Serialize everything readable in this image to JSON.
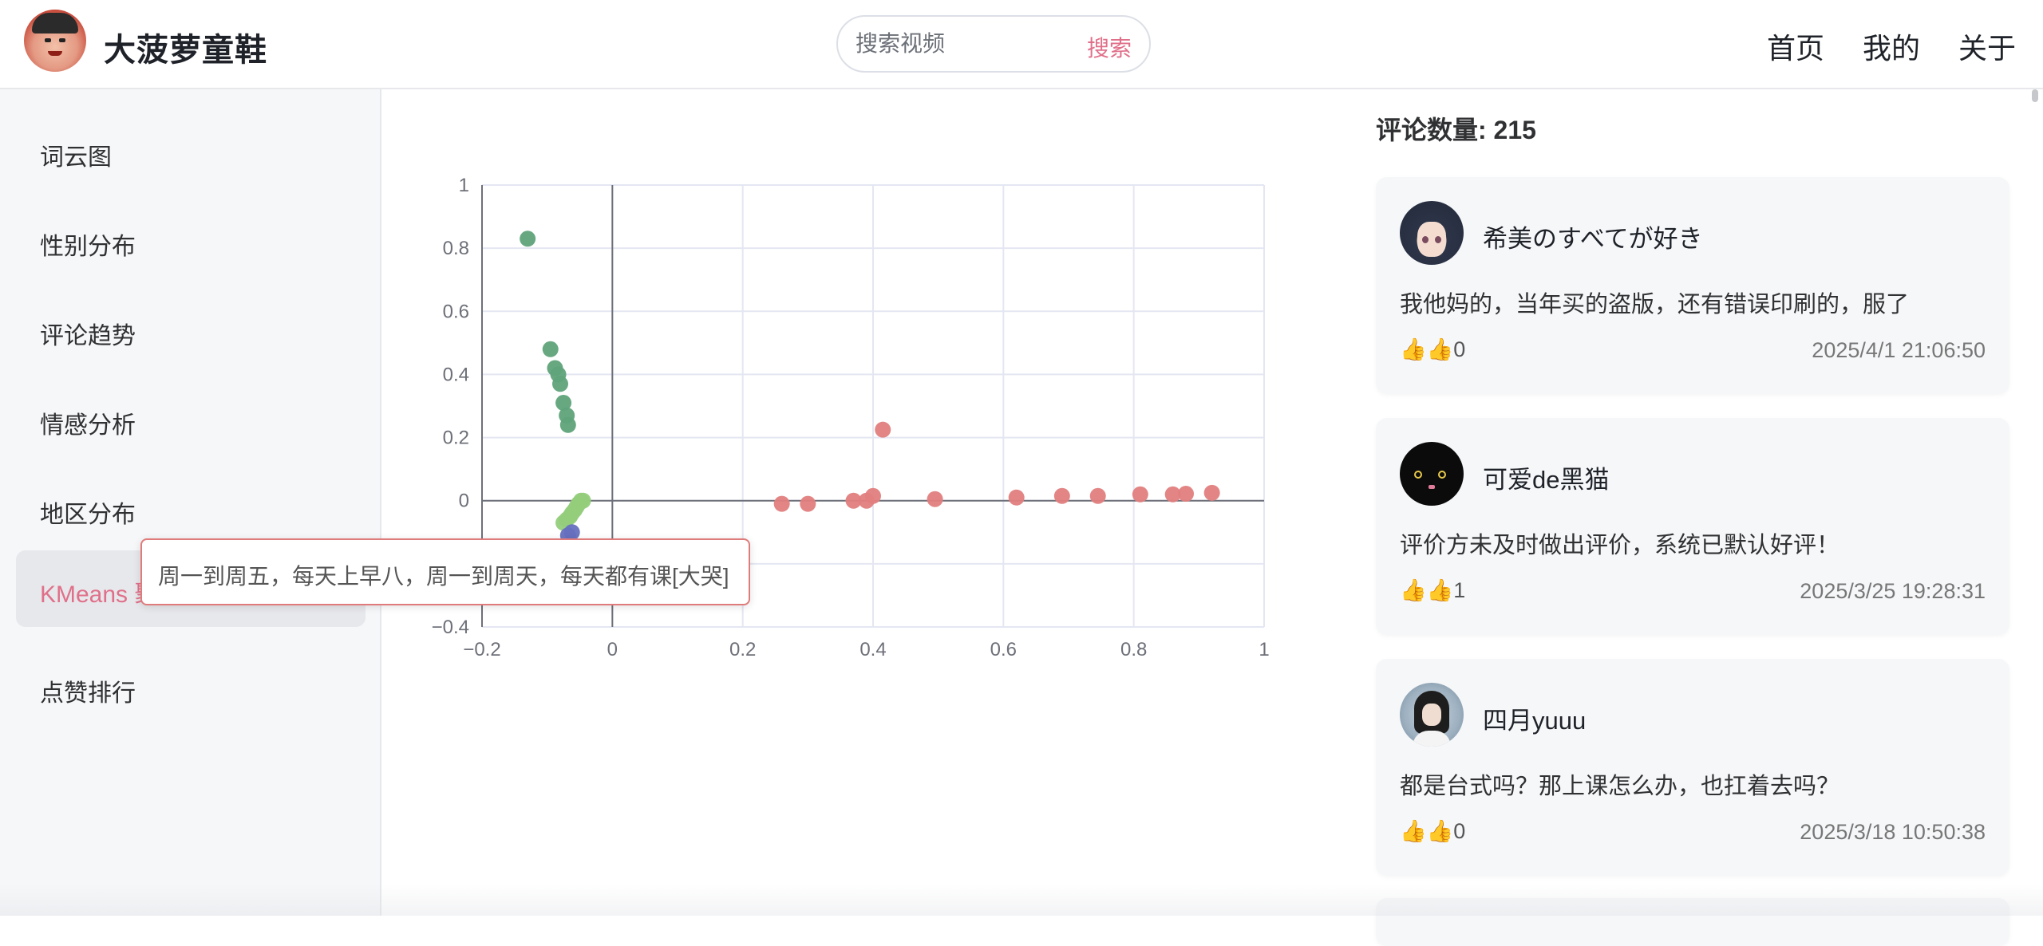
{
  "header": {
    "brand": "大菠萝童鞋",
    "search_placeholder": "搜索视频",
    "search_button": "搜索",
    "nav": [
      "首页",
      "我的",
      "关于"
    ]
  },
  "sidebar": {
    "items": [
      {
        "label": "词云图",
        "active": false
      },
      {
        "label": "性别分布",
        "active": false
      },
      {
        "label": "评论趋势",
        "active": false
      },
      {
        "label": "情感分析",
        "active": false
      },
      {
        "label": "地区分布",
        "active": false
      },
      {
        "label": "KMeans 聚类",
        "active": true
      },
      {
        "label": "点赞排行",
        "active": false
      }
    ]
  },
  "tooltip": {
    "text": "周一到周五，每天上早八，周一到周天，每天都有课[大哭]"
  },
  "comments": {
    "count_label": "评论数量: 215",
    "items": [
      {
        "user": "希美のすべてが好き",
        "text": "我他妈的，当年买的盗版，还有错误印刷的，服了",
        "likes": "👍👍0",
        "time": "2025/4/1 21:06:50"
      },
      {
        "user": "可爱de黑猫",
        "text": "评价方未及时做出评价，系统已默认好评！",
        "likes": "👍👍1",
        "time": "2025/3/25 19:28:31"
      },
      {
        "user": "四月yuuu",
        "text": "都是台式吗？那上课怎么办，也扛着去吗？",
        "likes": "👍👍0",
        "time": "2025/3/18 10:50:38"
      }
    ]
  },
  "chart_data": {
    "type": "scatter",
    "title": "",
    "xlabel": "",
    "ylabel": "",
    "xlim": [
      -0.2,
      1
    ],
    "ylim": [
      -0.4,
      1
    ],
    "xticks": [
      "−0.2",
      "0",
      "0.2",
      "0.4",
      "0.6",
      "0.8",
      "1"
    ],
    "yticks": [
      "−0.4",
      "−0.2",
      "0",
      "0.2",
      "0.4",
      "0.6",
      "0.8",
      "1"
    ],
    "grid": true,
    "series": [
      {
        "color": "#5fa37a",
        "points": [
          [
            -0.13,
            0.83
          ],
          [
            -0.095,
            0.48
          ],
          [
            -0.088,
            0.42
          ],
          [
            -0.083,
            0.4
          ],
          [
            -0.08,
            0.37
          ],
          [
            -0.075,
            0.31
          ],
          [
            -0.07,
            0.27
          ],
          [
            -0.068,
            0.24
          ]
        ]
      },
      {
        "color": "#93cd7b",
        "points": [
          [
            -0.075,
            -0.07
          ],
          [
            -0.07,
            -0.06
          ],
          [
            -0.065,
            -0.05
          ],
          [
            -0.062,
            -0.04
          ],
          [
            -0.058,
            -0.03
          ],
          [
            -0.055,
            -0.02
          ],
          [
            -0.052,
            -0.01
          ],
          [
            -0.048,
            0.0
          ],
          [
            -0.045,
            0.0
          ]
        ]
      },
      {
        "color": "#6670bf",
        "points": [
          [
            -0.068,
            -0.11
          ],
          [
            -0.062,
            -0.1
          ]
        ]
      },
      {
        "color": "#e27e7e",
        "points": [
          [
            0.26,
            -0.01
          ],
          [
            0.3,
            -0.01
          ],
          [
            0.37,
            0.0
          ],
          [
            0.39,
            0.0
          ],
          [
            0.4,
            0.015
          ],
          [
            0.415,
            0.225
          ],
          [
            0.495,
            0.005
          ],
          [
            0.62,
            0.01
          ],
          [
            0.69,
            0.015
          ],
          [
            0.745,
            0.015
          ],
          [
            0.81,
            0.02
          ],
          [
            0.86,
            0.02
          ],
          [
            0.88,
            0.022
          ],
          [
            0.92,
            0.025
          ]
        ]
      }
    ]
  }
}
